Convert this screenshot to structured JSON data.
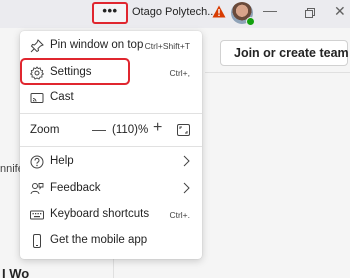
{
  "titlebar": {
    "more_glyph": "•••",
    "org_name": "Otago Polytech...",
    "min_glyph": "—",
    "max_glyph": "▫",
    "close_glyph": "✕"
  },
  "background": {
    "join_button": "Join or create team",
    "left_fragment": "nnife",
    "bottom_fragment": "I Wo"
  },
  "menu": {
    "items": [
      {
        "label": "Pin window on top",
        "shortcut": "Ctrl+Shift+T",
        "icon": "pin-icon"
      },
      {
        "label": "Settings",
        "shortcut": "Ctrl+,",
        "icon": "gear-icon"
      },
      {
        "label": "Cast",
        "shortcut": "",
        "icon": "cast-icon"
      },
      {
        "label": "Help",
        "shortcut": "",
        "icon": "help-icon"
      },
      {
        "label": "Feedback",
        "shortcut": "",
        "icon": "feedback-icon"
      },
      {
        "label": "Keyboard shortcuts",
        "shortcut": "Ctrl+.",
        "icon": "keyboard-icon"
      },
      {
        "label": "Get the mobile app",
        "shortcut": "",
        "icon": "mobile-icon"
      }
    ],
    "zoom": {
      "label": "Zoom",
      "minus": "—",
      "value": "(110)%",
      "plus": "+"
    }
  },
  "colors": {
    "highlight": "#e0262f",
    "warning": "#d83b01",
    "presence": "#13a10e"
  }
}
